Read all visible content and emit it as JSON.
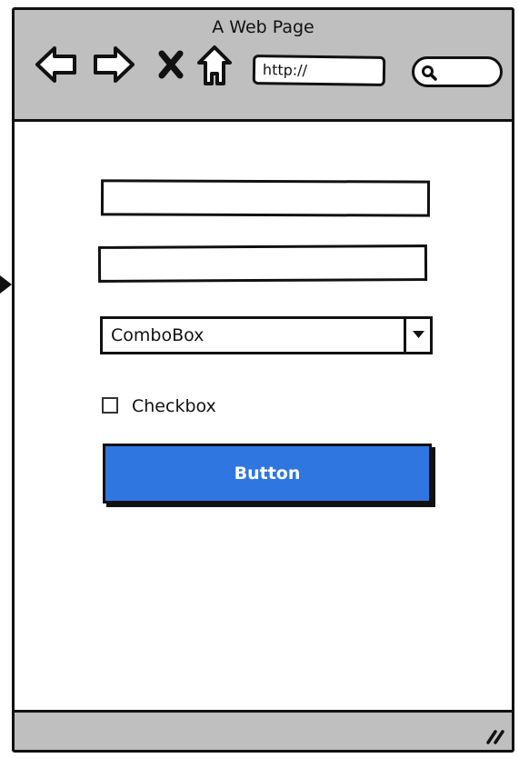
{
  "window": {
    "title": "A Web Page"
  },
  "toolbar": {
    "icons": [
      "back-arrow-icon",
      "forward-arrow-icon",
      "close-icon",
      "home-icon"
    ],
    "url_value": "http://",
    "search_icon": "search-icon"
  },
  "form": {
    "textbox1_value": "",
    "textbox2_value": "",
    "combobox_value": "ComboBox",
    "checkbox_label": "Checkbox",
    "checkbox_checked": false,
    "button_label": "Button"
  },
  "colors": {
    "accent": "#2f76e1",
    "chrome": "#bfbfbf",
    "stroke": "#111111"
  },
  "statusbar": {
    "grip_icon": "resize-grip-icon"
  }
}
